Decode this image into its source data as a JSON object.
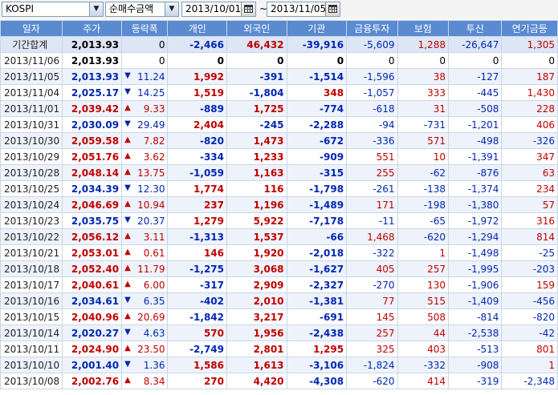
{
  "toolbar": {
    "market": "KOSPI",
    "view": "순매수금액",
    "date_from": "2013/10/01",
    "date_to": "2013/11/05",
    "range_sep": "~"
  },
  "table": {
    "headers": [
      "일자",
      "주가",
      "등락폭",
      "개인",
      "외국인",
      "기관",
      "금융투자",
      "보험",
      "투신",
      "연기금등"
    ],
    "rows": [
      {
        "date": "기간합계",
        "price": "2,013.93",
        "dir": "",
        "chg": "0",
        "retail": "-2,466",
        "foreign": "46,432",
        "inst": "-39,916",
        "fin": "-5,609",
        "ins": "1,288",
        "trust": "-26,647",
        "pension": "1,305"
      },
      {
        "date": "2013/11/06",
        "price": "2,013.93",
        "dir": "",
        "chg": "0",
        "retail": "0",
        "foreign": "0",
        "inst": "0",
        "fin": "0",
        "ins": "0",
        "trust": "0",
        "pension": "0"
      },
      {
        "date": "2013/11/05",
        "price": "2,013.93",
        "dir": "down",
        "chg": "11.24",
        "retail": "1,992",
        "foreign": "-391",
        "inst": "-1,514",
        "fin": "-1,596",
        "ins": "38",
        "trust": "-127",
        "pension": "187"
      },
      {
        "date": "2013/11/04",
        "price": "2,025.17",
        "dir": "down",
        "chg": "14.25",
        "retail": "1,519",
        "foreign": "-1,804",
        "inst": "348",
        "fin": "-1,057",
        "ins": "333",
        "trust": "-445",
        "pension": "1,430"
      },
      {
        "date": "2013/11/01",
        "price": "2,039.42",
        "dir": "up",
        "chg": "9.33",
        "retail": "-889",
        "foreign": "1,725",
        "inst": "-774",
        "fin": "-618",
        "ins": "31",
        "trust": "-508",
        "pension": "228"
      },
      {
        "date": "2013/10/31",
        "price": "2,030.09",
        "dir": "down",
        "chg": "29.49",
        "retail": "2,404",
        "foreign": "-245",
        "inst": "-2,288",
        "fin": "-94",
        "ins": "-731",
        "trust": "-1,201",
        "pension": "406"
      },
      {
        "date": "2013/10/30",
        "price": "2,059.58",
        "dir": "up",
        "chg": "7.82",
        "retail": "-820",
        "foreign": "1,473",
        "inst": "-672",
        "fin": "-336",
        "ins": "571",
        "trust": "-498",
        "pension": "-326"
      },
      {
        "date": "2013/10/29",
        "price": "2,051.76",
        "dir": "up",
        "chg": "3.62",
        "retail": "-334",
        "foreign": "1,233",
        "inst": "-909",
        "fin": "551",
        "ins": "10",
        "trust": "-1,391",
        "pension": "347"
      },
      {
        "date": "2013/10/28",
        "price": "2,048.14",
        "dir": "up",
        "chg": "13.75",
        "retail": "-1,059",
        "foreign": "1,163",
        "inst": "-315",
        "fin": "255",
        "ins": "-62",
        "trust": "-876",
        "pension": "63"
      },
      {
        "date": "2013/10/25",
        "price": "2,034.39",
        "dir": "down",
        "chg": "12.30",
        "retail": "1,774",
        "foreign": "116",
        "inst": "-1,798",
        "fin": "-261",
        "ins": "-138",
        "trust": "-1,374",
        "pension": "234"
      },
      {
        "date": "2013/10/24",
        "price": "2,046.69",
        "dir": "up",
        "chg": "10.94",
        "retail": "237",
        "foreign": "1,196",
        "inst": "-1,489",
        "fin": "171",
        "ins": "-198",
        "trust": "-1,380",
        "pension": "57"
      },
      {
        "date": "2013/10/23",
        "price": "2,035.75",
        "dir": "down",
        "chg": "20.37",
        "retail": "1,279",
        "foreign": "5,922",
        "inst": "-7,178",
        "fin": "-11",
        "ins": "-65",
        "trust": "-1,972",
        "pension": "316"
      },
      {
        "date": "2013/10/22",
        "price": "2,056.12",
        "dir": "up",
        "chg": "3.11",
        "retail": "-1,313",
        "foreign": "1,537",
        "inst": "-66",
        "fin": "1,468",
        "ins": "-620",
        "trust": "-1,294",
        "pension": "814"
      },
      {
        "date": "2013/10/21",
        "price": "2,053.01",
        "dir": "up",
        "chg": "0.61",
        "retail": "146",
        "foreign": "1,920",
        "inst": "-2,018",
        "fin": "-322",
        "ins": "1",
        "trust": "-1,498",
        "pension": "-25"
      },
      {
        "date": "2013/10/18",
        "price": "2,052.40",
        "dir": "up",
        "chg": "11.79",
        "retail": "-1,275",
        "foreign": "3,068",
        "inst": "-1,627",
        "fin": "405",
        "ins": "257",
        "trust": "-1,995",
        "pension": "-203"
      },
      {
        "date": "2013/10/17",
        "price": "2,040.61",
        "dir": "up",
        "chg": "6.00",
        "retail": "-317",
        "foreign": "2,909",
        "inst": "-2,327",
        "fin": "-270",
        "ins": "130",
        "trust": "-1,906",
        "pension": "159"
      },
      {
        "date": "2013/10/16",
        "price": "2,034.61",
        "dir": "down",
        "chg": "6.35",
        "retail": "-402",
        "foreign": "2,010",
        "inst": "-1,381",
        "fin": "77",
        "ins": "515",
        "trust": "-1,409",
        "pension": "-456"
      },
      {
        "date": "2013/10/15",
        "price": "2,040.96",
        "dir": "up",
        "chg": "20.69",
        "retail": "-1,842",
        "foreign": "3,217",
        "inst": "-691",
        "fin": "145",
        "ins": "508",
        "trust": "-814",
        "pension": "-820"
      },
      {
        "date": "2013/10/14",
        "price": "2,020.27",
        "dir": "down",
        "chg": "4.63",
        "retail": "570",
        "foreign": "1,956",
        "inst": "-2,438",
        "fin": "257",
        "ins": "44",
        "trust": "-2,538",
        "pension": "-42"
      },
      {
        "date": "2013/10/11",
        "price": "2,024.90",
        "dir": "up",
        "chg": "23.50",
        "retail": "-2,749",
        "foreign": "2,801",
        "inst": "1,295",
        "fin": "325",
        "ins": "403",
        "trust": "-513",
        "pension": "801"
      },
      {
        "date": "2013/10/10",
        "price": "2,001.40",
        "dir": "down",
        "chg": "1.36",
        "retail": "1,586",
        "foreign": "1,613",
        "inst": "-3,106",
        "fin": "-1,824",
        "ins": "-332",
        "trust": "-908",
        "pension": "1"
      },
      {
        "date": "2013/10/08",
        "price": "2,002.76",
        "dir": "up",
        "chg": "8.34",
        "retail": "270",
        "foreign": "4,420",
        "inst": "-4,308",
        "fin": "-620",
        "ins": "414",
        "trust": "-319",
        "pension": "-2,348"
      }
    ]
  },
  "colors": {
    "header_bg": "#5a8ad0",
    "up": "#c00000",
    "down": "#0026b3",
    "total_bg": "#dde6f5"
  },
  "icons": {
    "dropdown": "chevron-down-icon",
    "calendar": "calendar-icon",
    "up": "triangle-up-icon",
    "down": "triangle-down-icon"
  }
}
